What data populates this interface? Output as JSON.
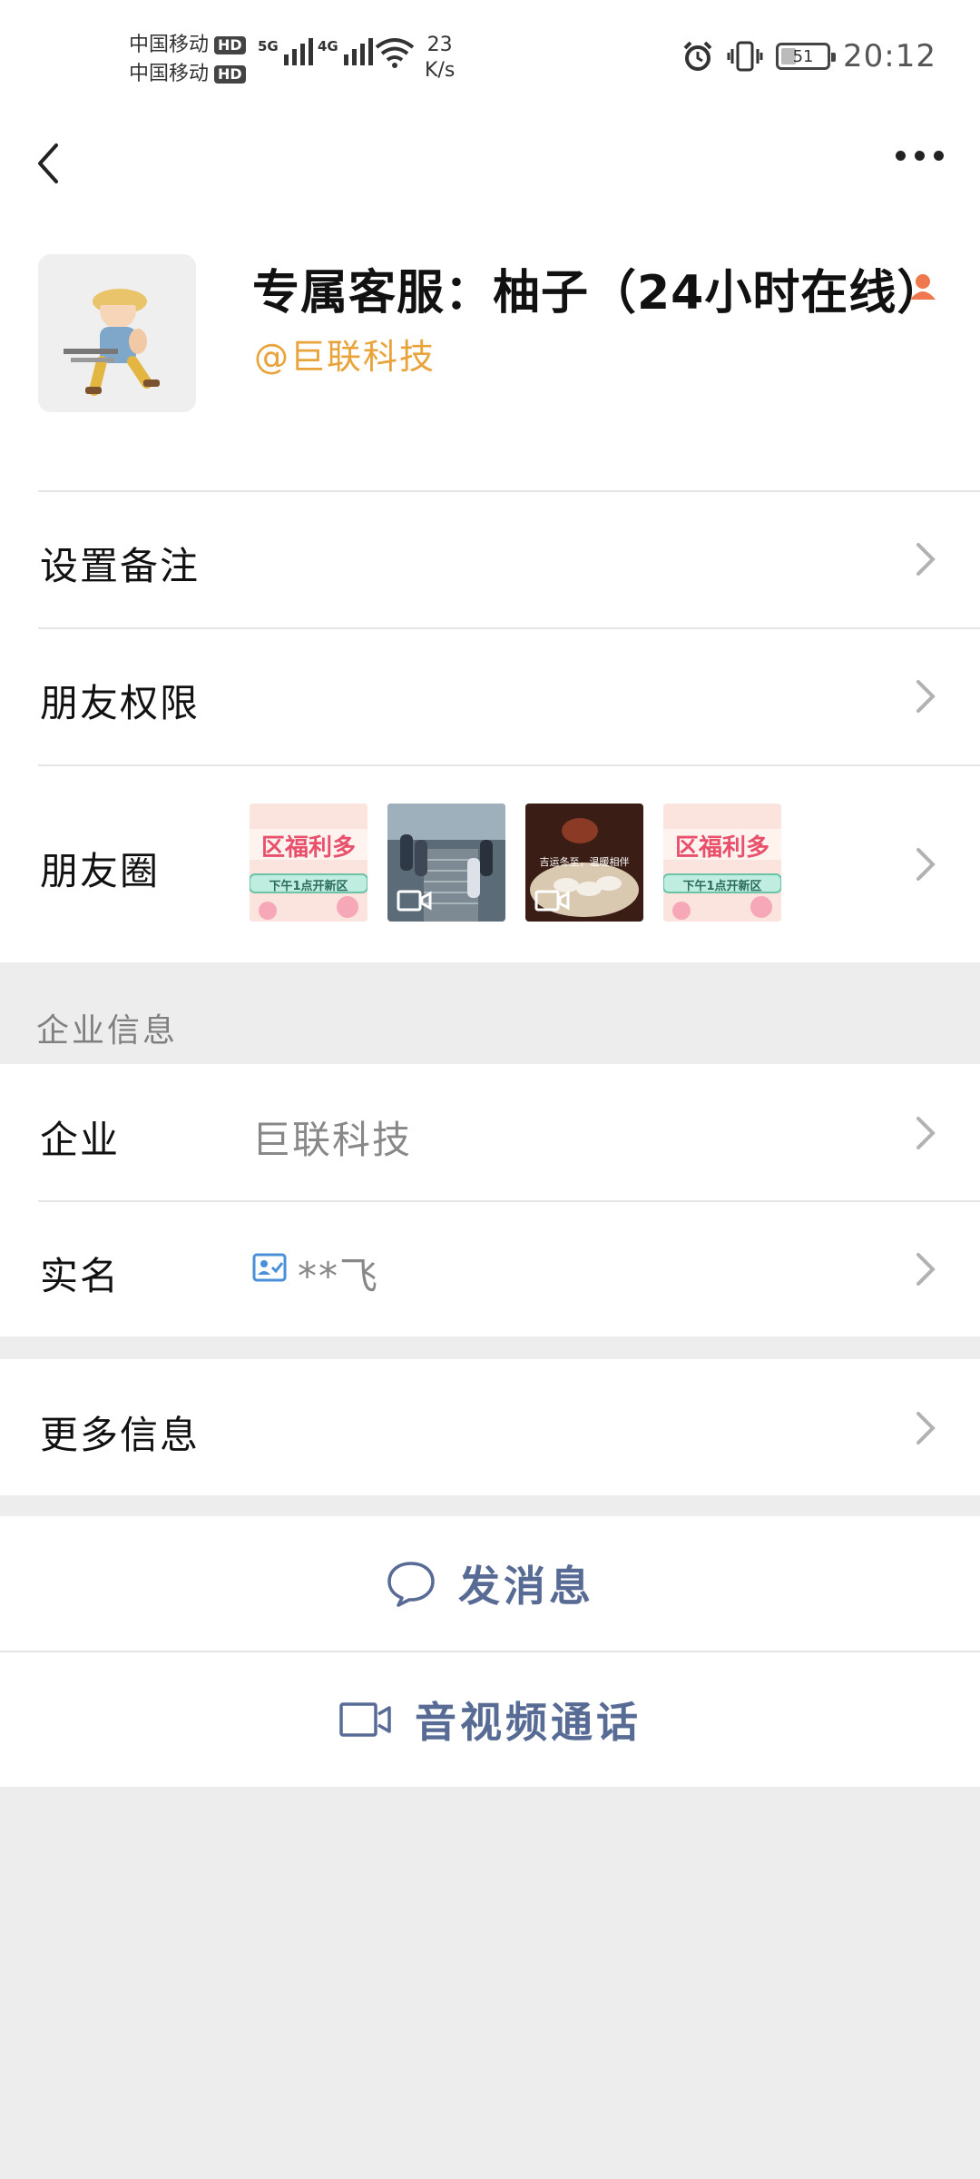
{
  "status_bar": {
    "carrier_1": "中国移动",
    "carrier_2": "中国移动",
    "hd_badge": "HD",
    "network_1": "5G",
    "network_2": "4G",
    "speed_value": "23",
    "speed_unit": "K/s",
    "battery_level": "51",
    "time": "20:12"
  },
  "profile": {
    "name": "专属客服：柚子（24小时在线）",
    "company_tag": "@巨联科技"
  },
  "rows": {
    "remark": "设置备注",
    "permissions": "朋友权限",
    "moments": "朋友圈"
  },
  "moments_thumbs": [
    {
      "kind": "banner",
      "title": "区福利多",
      "subtitle": "下午1点开新区"
    },
    {
      "kind": "video"
    },
    {
      "kind": "video-food",
      "caption": "吉运冬至，温暖相伴"
    },
    {
      "kind": "banner",
      "title": "区福利多",
      "subtitle": "下午1点开新区"
    }
  ],
  "enterprise_section": {
    "title": "企业信息",
    "company_label": "企业",
    "company_value": "巨联科技",
    "realname_label": "实名",
    "realname_value": "**飞"
  },
  "more_info": "更多信息",
  "actions": {
    "send_message": "发消息",
    "av_call": "音视频通话"
  },
  "colors": {
    "accent_link": "#576b95",
    "company_tag": "#e8a33b",
    "background": "#ededed"
  }
}
